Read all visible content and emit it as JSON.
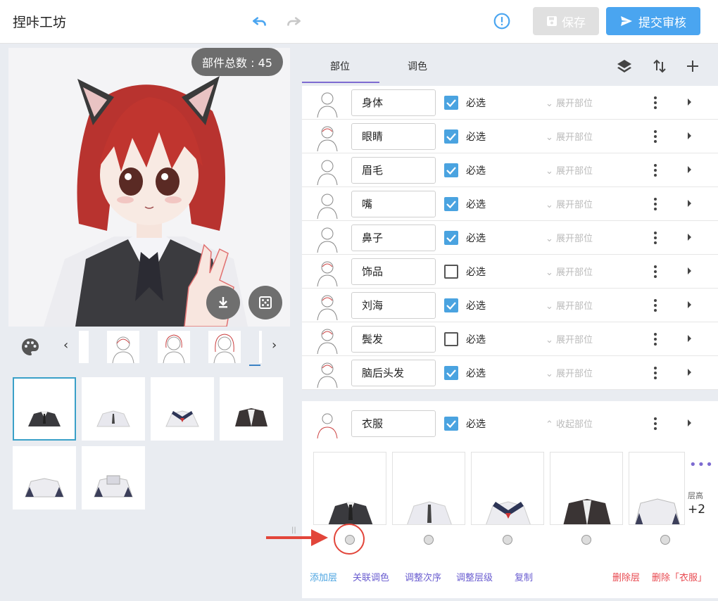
{
  "app": {
    "title": "捏咔工坊"
  },
  "toolbar": {
    "save_label": "保存",
    "submit_label": "提交审核"
  },
  "preview": {
    "part_count_label": "部件总数 : 45"
  },
  "tabs": [
    {
      "label": "部位",
      "active": true
    },
    {
      "label": "调色",
      "active": false
    }
  ],
  "parts": [
    {
      "name": "身体",
      "checked": true,
      "required_label": "必选",
      "expand_label": "展开部位"
    },
    {
      "name": "眼睛",
      "checked": true,
      "required_label": "必选",
      "expand_label": "展开部位"
    },
    {
      "name": "眉毛",
      "checked": true,
      "required_label": "必选",
      "expand_label": "展开部位"
    },
    {
      "name": "嘴",
      "checked": true,
      "required_label": "必选",
      "expand_label": "展开部位"
    },
    {
      "name": "鼻子",
      "checked": true,
      "required_label": "必选",
      "expand_label": "展开部位"
    },
    {
      "name": "饰品",
      "checked": false,
      "required_label": "必选",
      "expand_label": "展开部位"
    },
    {
      "name": "刘海",
      "checked": true,
      "required_label": "必选",
      "expand_label": "展开部位"
    },
    {
      "name": "鬓发",
      "checked": false,
      "required_label": "必选",
      "expand_label": "展开部位"
    },
    {
      "name": "脑后头发",
      "checked": true,
      "required_label": "必选",
      "expand_label": "展开部位"
    }
  ],
  "open_part": {
    "name": "衣服",
    "checked": true,
    "required_label": "必选",
    "collapse_label": "收起部位",
    "layer_height_label": "层高",
    "layer_height_value": "+2",
    "actions": {
      "add_layer": "添加层",
      "link_color": "关联调色",
      "adjust_order": "调整次序",
      "adjust_level": "调整层级",
      "copy": "复制",
      "delete_layer": "删除层",
      "delete_part": "删除「衣服」"
    }
  },
  "colors": {
    "accent": "#4aa5f0",
    "purple": "#7d6bd1",
    "danger": "#e8484f",
    "check": "#4aa3e0"
  },
  "icons": [
    "undo-icon",
    "redo-icon",
    "info-icon",
    "save-icon",
    "send-icon",
    "download-icon",
    "dice-icon",
    "palette-icon",
    "layers-icon",
    "sort-icon",
    "plus-icon",
    "more-vert-icon",
    "chevron-right-icon",
    "chevron-down-icon",
    "chevron-up-icon"
  ]
}
